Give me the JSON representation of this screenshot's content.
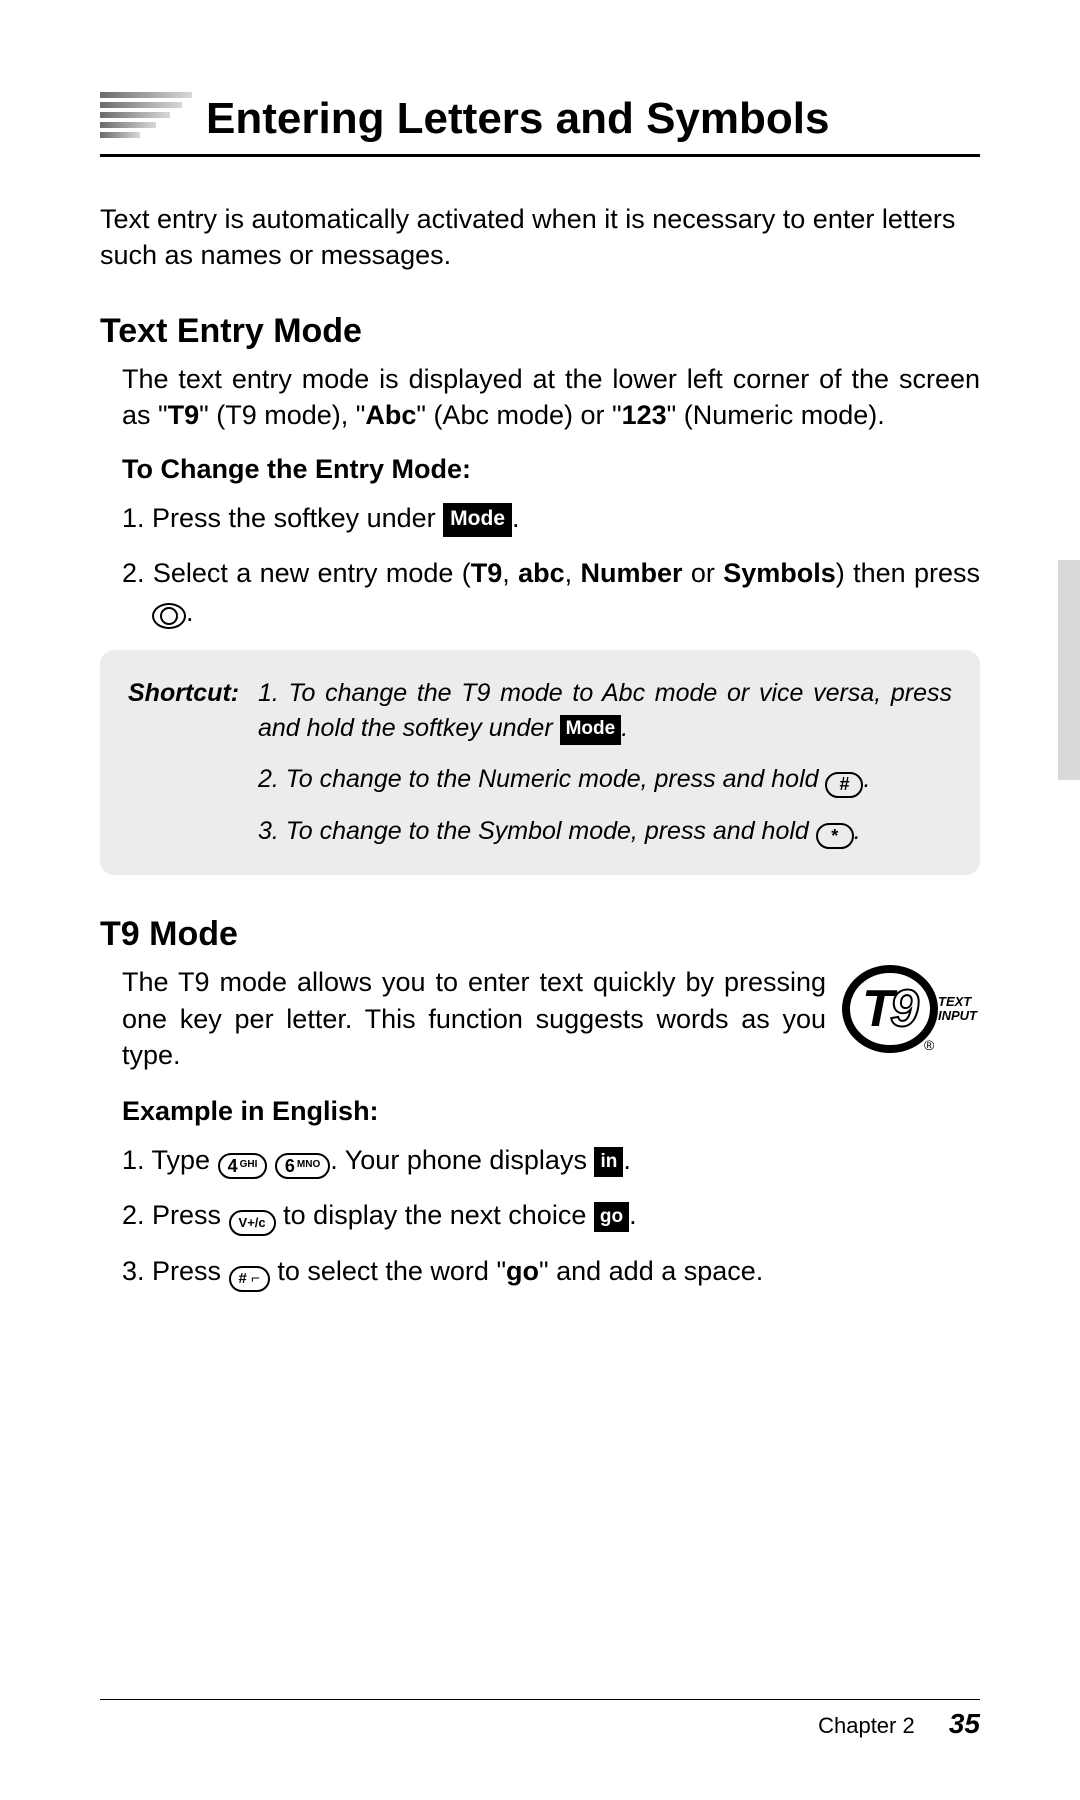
{
  "page_title": "Entering Letters and Symbols",
  "intro": "Text entry is automatically activated when it is necessary to enter letters such as names or messages.",
  "text_entry": {
    "heading": "Text Entry Mode",
    "para_a": "The text entry mode is displayed at the lower left corner of the screen as \"",
    "t9": "T9",
    "para_b": "\" (T9 mode), \"",
    "abc": "Abc",
    "para_c": "\" (Abc mode) or \"",
    "num": "123",
    "para_d": "\" (Numeric mode).",
    "change_heading": "To Change the Entry Mode:",
    "step1_a": "1. Press the softkey under ",
    "mode_label": "Mode",
    "step1_b": ".",
    "step2_a": "2. Select a new entry mode (",
    "s2_t9": "T9",
    "s2_sep1": ", ",
    "s2_abc": "abc",
    "s2_sep2": ", ",
    "s2_num": "Number",
    "s2_sep3": " or ",
    "s2_sym": "Symbols",
    "s2_end": ") then press ",
    "s2_dot": "."
  },
  "shortcut": {
    "label": "Shortcut:",
    "r1_a": "1. To change the T9 mode to Abc mode or vice versa, press and hold the softkey under ",
    "r1_b": ".",
    "r2": "2. To change to the Numeric mode, press and hold ",
    "r2_key": "#",
    "r2_b": ".",
    "r3": "3. To change to the Symbol mode, press and hold ",
    "r3_key": "*",
    "r3_b": "."
  },
  "t9": {
    "heading": "T9 Mode",
    "para": "The T9 mode allows you to enter text quickly by pressing one key per letter. This function suggests words as you type.",
    "logo_text": "TEXT",
    "logo_input": "INPUT",
    "example_heading": "Example in English:",
    "s1_a": "1.  Type ",
    "k4": "4",
    "k4s": "GHI",
    "k6": "6",
    "k6s": "MNO",
    "s1_b": ". Your phone displays  ",
    "disp1": "in",
    "s1_c": ".",
    "s2_a": "2.  Press ",
    "kv": "V+/c",
    "s2_b": " to display the next choice  ",
    "disp2": "go",
    "s2_c": ".",
    "s3_a": "3.  Press ",
    "k_hash": "# ⌐",
    "s3_b": " to select the word \"",
    "s3_go": "go",
    "s3_c": "\" and add a space."
  },
  "footer": {
    "chapter": "Chapter 2",
    "page": "35"
  }
}
